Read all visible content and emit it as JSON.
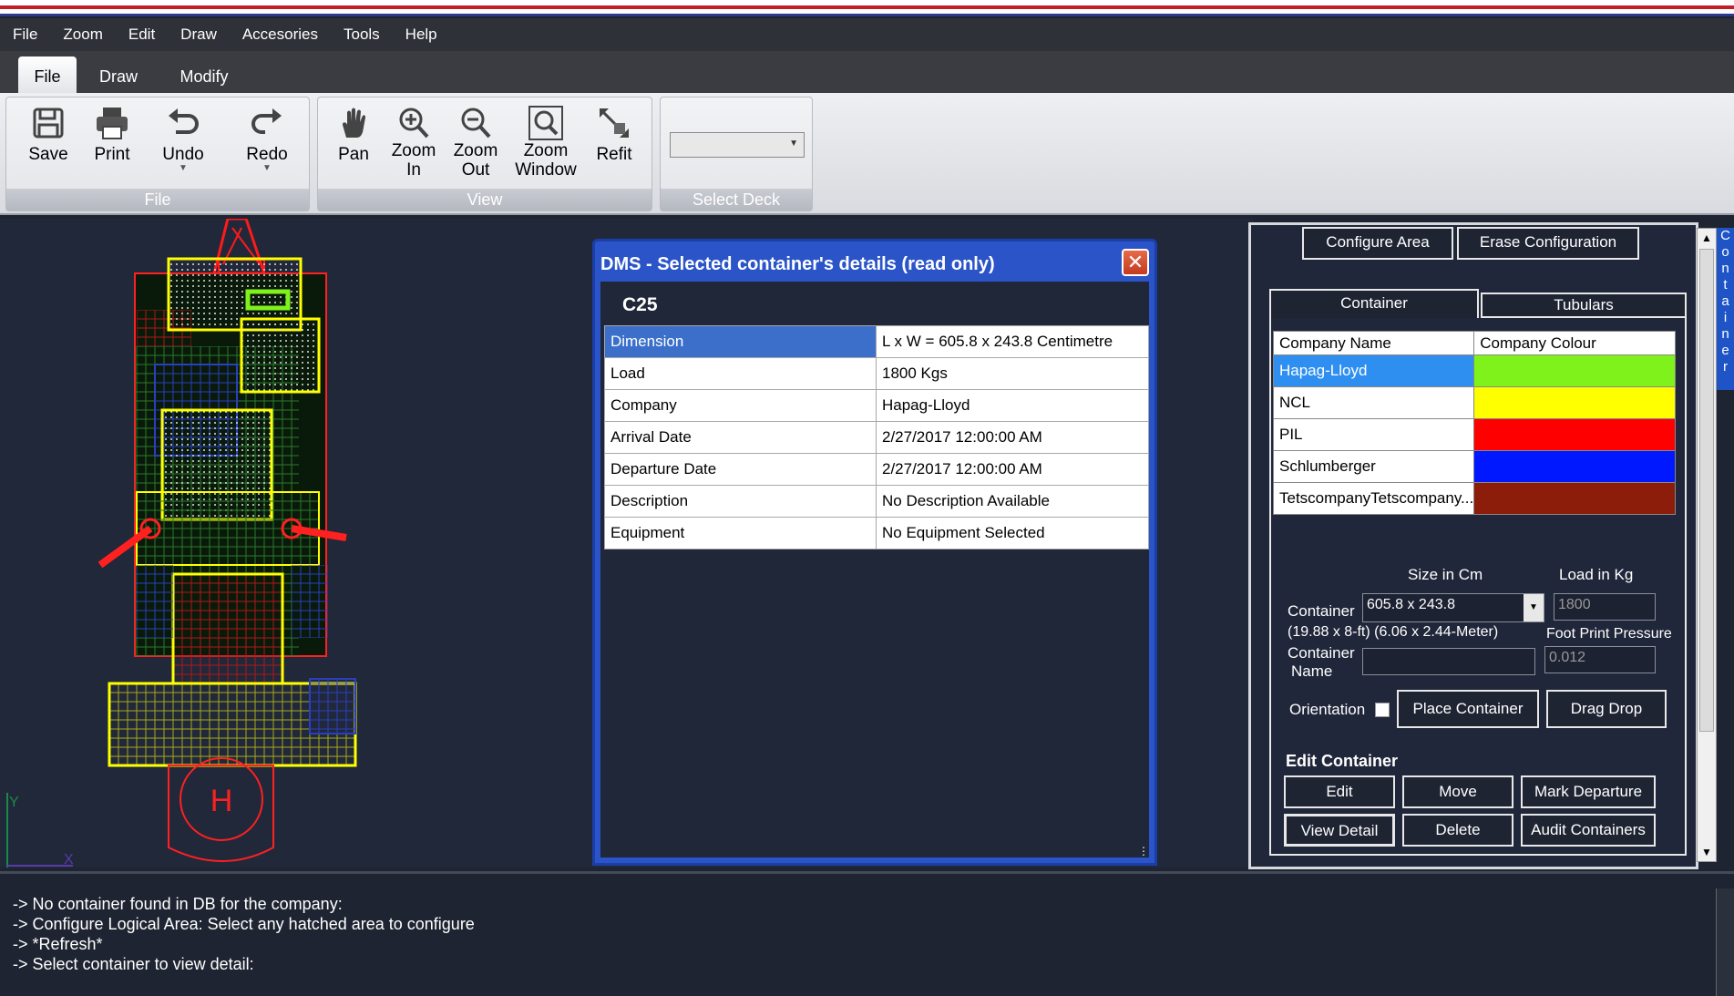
{
  "menu": [
    "File",
    "Zoom",
    "Edit",
    "Draw",
    "Accesories",
    "Tools",
    "Help"
  ],
  "tabs": [
    "File",
    "Draw",
    "Modify"
  ],
  "ribbon": {
    "file_group": "File",
    "view_group": "View",
    "deck_group": "Select Deck",
    "save": "Save",
    "print": "Print",
    "undo": "Undo",
    "redo": "Redo",
    "pan": "Pan",
    "zoom_in_1": "Zoom",
    "zoom_in_2": "In",
    "zoom_out_1": "Zoom",
    "zoom_out_2": "Out",
    "zoom_window_1": "Zoom",
    "zoom_window_2": "Window",
    "refit": "Refit",
    "deck_value": ""
  },
  "canvas": {
    "helipad": "H",
    "axis_y": "Y",
    "axis_x": "X"
  },
  "dialog": {
    "title": "DMS - Selected container's details (read only)",
    "container": "C25",
    "rows": [
      {
        "k": "Dimension",
        "v": "L x W = 605.8 x 243.8 Centimetre"
      },
      {
        "k": "Load",
        "v": "1800 Kgs"
      },
      {
        "k": "Company",
        "v": "Hapag-Lloyd"
      },
      {
        "k": "Arrival Date",
        "v": "2/27/2017 12:00:00 AM"
      },
      {
        "k": "Departure Date",
        "v": "2/27/2017 12:00:00 AM"
      },
      {
        "k": "Description",
        "v": "No Description Available"
      },
      {
        "k": "Equipment",
        "v": "No Equipment Selected"
      }
    ]
  },
  "panel": {
    "configure_area": "Configure Area",
    "erase_configuration": "Erase Configuration",
    "tab_container": "Container",
    "tab_tubulars": "Tubulars",
    "col_company": "Company Name",
    "col_colour": "Company Colour",
    "companies": [
      {
        "name": "Hapag-Lloyd",
        "color": "#7ef21a"
      },
      {
        "name": "NCL",
        "color": "#ffff00"
      },
      {
        "name": "PIL",
        "color": "#ff0000"
      },
      {
        "name": "Schlumberger",
        "color": "#0018ff"
      },
      {
        "name": "TetscompanyTetscompany...",
        "color": "#8b1d0a"
      }
    ],
    "size_label": "Size  in Cm",
    "load_label": "Load  in Kg",
    "container_label": "Container",
    "size_value": "605.8 x 243.8",
    "load_value": "1800",
    "size_note": "(19.88 x 8-ft) (6.06 x 2.44-Meter)",
    "foot_print": "Foot Print Pressure",
    "container_name_1": "Container",
    "container_name_2": "Name",
    "pressure_value": "0.012",
    "orientation": "Orientation",
    "place": "Place Container",
    "drag": "Drag Drop",
    "edit_container": "Edit Container",
    "edit": "Edit",
    "move": "Move",
    "mark_departure": "Mark Departure",
    "view_detail": "View Detail",
    "delete": "Delete",
    "audit": "Audit Containers"
  },
  "right_strip": [
    "C",
    "o",
    "n",
    "t",
    "a",
    "i",
    "n",
    "e",
    "r"
  ],
  "log": [
    "-> No container found in DB for the company:",
    "-> Configure Logical Area: Select any hatched area to configure",
    "-> *Refresh*",
    "-> Select container to view detail:"
  ]
}
